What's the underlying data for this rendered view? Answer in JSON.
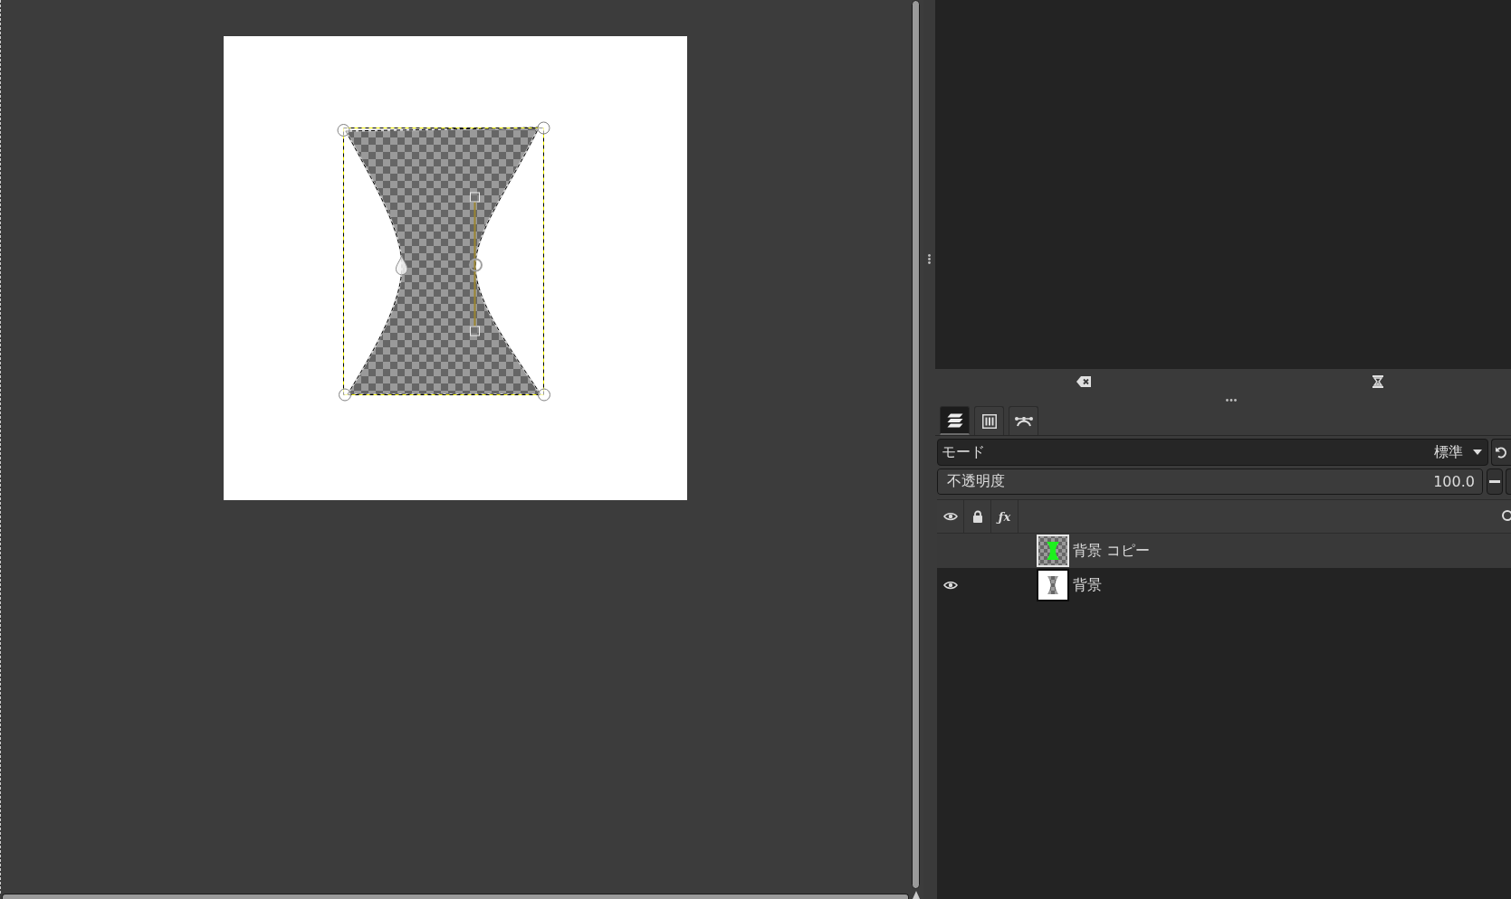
{
  "tabs": [
    {
      "selected": true
    },
    {
      "selected": false
    },
    {
      "selected": false
    }
  ],
  "mode": {
    "label": "モード",
    "value": "標準"
  },
  "opacity": {
    "label": "不透明度",
    "value": "100.0",
    "level": 1
  },
  "layer_list": {
    "effects_column": "ƒx",
    "layers": [
      {
        "name": "背景 コピー",
        "visible": false,
        "selected": true
      },
      {
        "name": "背景",
        "visible": true,
        "selected": false
      }
    ]
  }
}
